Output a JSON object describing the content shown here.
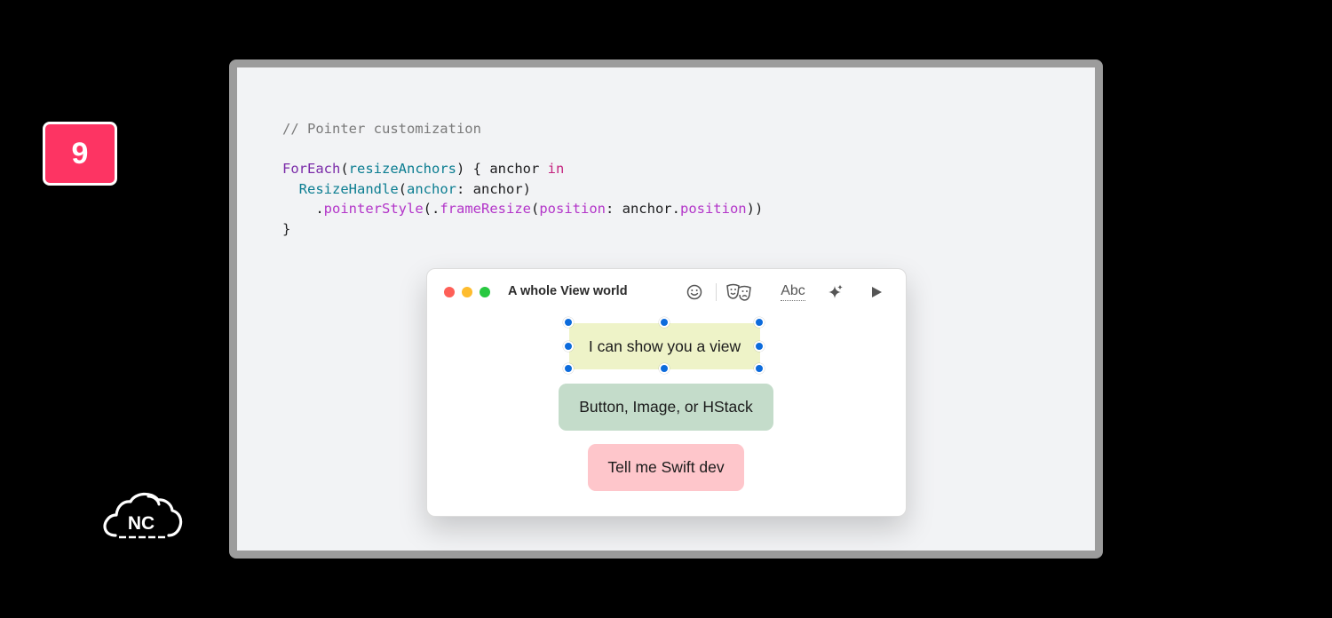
{
  "badge": {
    "number": "9"
  },
  "logo": {
    "text": "NC"
  },
  "code": {
    "comment": "// Pointer customization",
    "foreach_kw": "ForEach",
    "foreach_arg": "resizeAnchors",
    "open_brace": ") { anchor ",
    "in_kw": "in",
    "handle_type": "ResizeHandle",
    "anchor_label": "anchor",
    "anchor_value": ": anchor)",
    "dot": ".",
    "pointer_style": "pointerStyle",
    "paren_dot": "(.",
    "frame_resize": "frameResize",
    "paren": "(",
    "position_label": "position",
    "position_mid": ": anchor.",
    "position_prop": "position",
    "close_parens": "))",
    "close_brace": "}"
  },
  "window": {
    "title": "A whole View world",
    "toolbar": {
      "text_tool_label": "Abc"
    },
    "items": {
      "selected": "I can show you a view",
      "button": "Button, Image, or HStack",
      "tell": "Tell me Swift dev"
    }
  },
  "colors": {
    "badge": "#fd3463",
    "handle": "#0c6bdc",
    "chip_selected": "#eef3c8",
    "chip_button": "#c4dcca",
    "chip_tell": "#fec6cb"
  }
}
